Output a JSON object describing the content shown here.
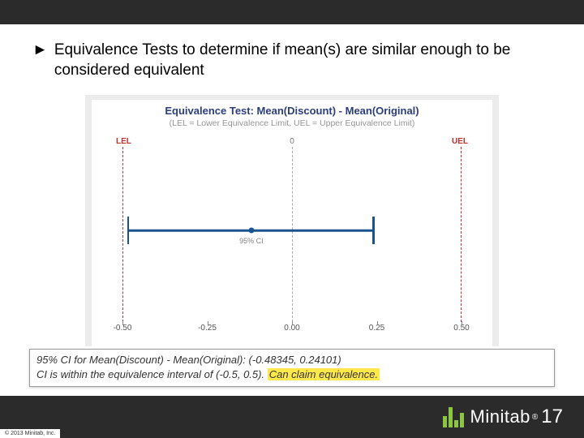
{
  "bullet": {
    "marker": "►",
    "text": "Equivalence Tests to determine if mean(s) are similar enough to be considered equivalent"
  },
  "chart": {
    "title": "Equivalence Test: Mean(Discount) - Mean(Original)",
    "subtitle": "(LEL = Lower Equivalence Limit, UEL = Upper Equivalence Limit)",
    "lel_label": "LEL",
    "uel_label": "UEL",
    "zero_label": "0",
    "ci_label": "95% CI",
    "ticks": [
      "-0.50",
      "-0.25",
      "0.00",
      "0.25",
      "0.50"
    ]
  },
  "chart_data": {
    "type": "interval",
    "xlim": [
      -0.5,
      0.5
    ],
    "lel": -0.5,
    "uel": 0.5,
    "center_line": 0,
    "ci_lower": -0.48345,
    "ci_upper": 0.24101,
    "point_estimate": -0.12,
    "xticks": [
      -0.5,
      -0.25,
      0.0,
      0.25,
      0.5
    ]
  },
  "result": {
    "line1": "95% CI for Mean(Discount) - Mean(Original): (-0.48345, 0.24101)",
    "line2_a": "CI is within the equivalence interval of (-0.5, 0.5). ",
    "line2_b": "Can claim equivalence."
  },
  "footer": {
    "brand": "Minitab",
    "reg": "®",
    "version": "17",
    "copyright": "© 2013 Minitab, Inc."
  }
}
